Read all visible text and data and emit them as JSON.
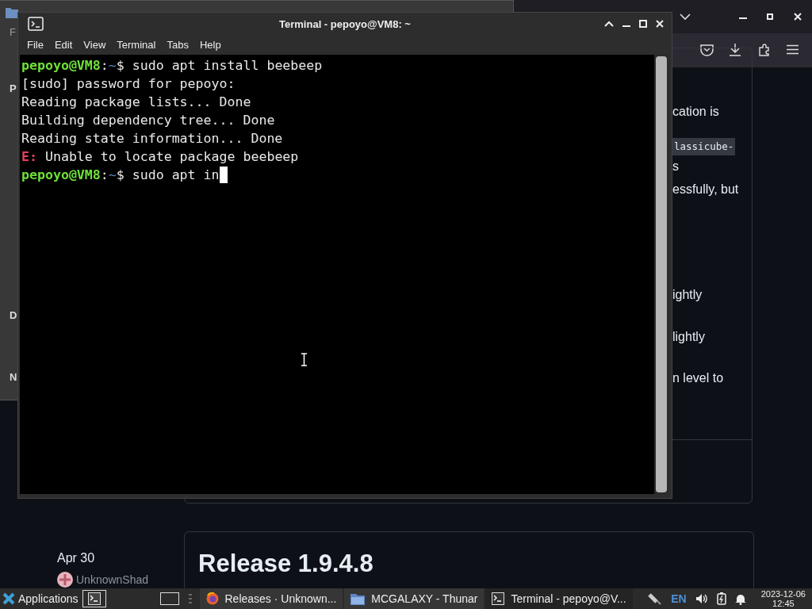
{
  "browser": {
    "content_fragments": [
      {
        "text": "cation is",
        "kind": "text"
      },
      {
        "text": "lassicube-",
        "kind": "code"
      },
      {
        "text": "s",
        "kind": "text"
      },
      {
        "text": "essfully, but",
        "kind": "text"
      },
      {
        "text": "ightly",
        "kind": "text"
      },
      {
        "text": "lightly",
        "kind": "text"
      },
      {
        "text": "n level to",
        "kind": "text"
      }
    ],
    "release_date": "Apr 30",
    "author": "UnknownShad",
    "release_title": "Release 1.9.4.8"
  },
  "file_manager": {
    "sidebar_fragments": [
      "F",
      "P",
      "D",
      "N"
    ]
  },
  "terminal": {
    "title": "Terminal - pepoyo@VM8: ~",
    "menu": [
      "File",
      "Edit",
      "View",
      "Terminal",
      "Tabs",
      "Help"
    ],
    "lines": [
      [
        {
          "text": "pepoyo@VM8",
          "kind": "user"
        },
        {
          "text": ":",
          "kind": "plain"
        },
        {
          "text": "~",
          "kind": "path"
        },
        {
          "text": "$ sudo apt install beebeep",
          "kind": "plain"
        }
      ],
      [
        {
          "text": "[sudo] password for pepoyo:",
          "kind": "plain"
        }
      ],
      [
        {
          "text": "Reading package lists... Done",
          "kind": "plain"
        }
      ],
      [
        {
          "text": "Building dependency tree... Done",
          "kind": "plain"
        }
      ],
      [
        {
          "text": "Reading state information... Done",
          "kind": "plain"
        }
      ],
      [
        {
          "text": "E:",
          "kind": "error"
        },
        {
          "text": " Unable to locate package beebeep",
          "kind": "plain"
        }
      ],
      [
        {
          "text": "pepoyo@VM8",
          "kind": "user"
        },
        {
          "text": ":",
          "kind": "plain"
        },
        {
          "text": "~",
          "kind": "path"
        },
        {
          "text": "$ sudo apt in",
          "kind": "plain"
        }
      ]
    ],
    "cursor": true
  },
  "taskbar": {
    "menu_label": "Applications",
    "tasks": [
      {
        "label": "Releases · Unknown...",
        "kind": "browser",
        "selected": false
      },
      {
        "label": "MCGALAXY - Thunar",
        "kind": "folder",
        "selected": false
      },
      {
        "label": "Terminal - pepoyo@V...",
        "kind": "terminal",
        "selected": true
      }
    ],
    "keyboard_layout": "EN",
    "date": "2023-12-06",
    "time": "12:45"
  }
}
